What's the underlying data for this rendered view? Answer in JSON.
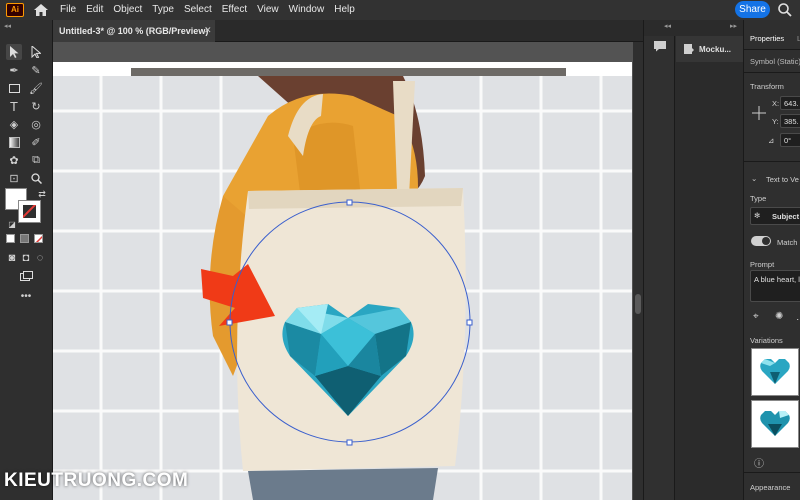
{
  "app": {
    "logo": "Ai",
    "menus": [
      "File",
      "Edit",
      "Object",
      "Type",
      "Select",
      "Effect",
      "View",
      "Window",
      "Help"
    ],
    "share_label": "Share"
  },
  "document": {
    "tab_title": "Untitled-3* @ 100 % (RGB/Preview)"
  },
  "middle_panel": {
    "mockup_label": "Mocku..."
  },
  "properties": {
    "tabs": [
      "Properties",
      "L"
    ],
    "selection_type": "Symbol (Static)",
    "transform_heading": "Transform",
    "x_label": "X:",
    "x_value": "643.",
    "y_label": "Y:",
    "y_value": "385.",
    "angle_value": "0°",
    "text_to_vector_heading": "Text to Ve",
    "type_label": "Type",
    "type_value": "Subject",
    "match_label": "Match",
    "prompt_label": "Prompt",
    "prompt_value": "A blue heart, l",
    "variations_label": "Variations",
    "appearance_label": "Appearance"
  },
  "watermark": "KIEUTRUONG.COM",
  "colors": {
    "accent": "#1473e6",
    "heart": "#2aa6c2",
    "arrow": "#f03a17",
    "bag": "#efe6d6",
    "jacket": "#e9a232",
    "selection": "#3a5fcd"
  }
}
